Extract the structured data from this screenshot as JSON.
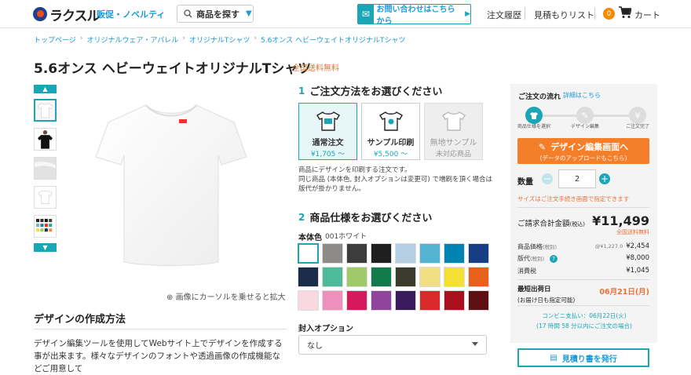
{
  "header": {
    "logo_text": "ラクスル",
    "promo_link": "販促・ノベルティ",
    "search_button": "商品を探す",
    "contact_button": "お問い合わせはこちらから",
    "order_history": "注文履歴",
    "estimate_list": "見積もりリスト",
    "cart_count": "0",
    "cart_label": "カート"
  },
  "breadcrumb": [
    "トップページ",
    "オリジナルウェア・アパレル",
    "オリジナルTシャツ",
    "5.6オンス ヘビーウェイトオリジナルTシャツ"
  ],
  "product": {
    "title": "5.6オンス ヘビーウェイトオリジナルTシャツ",
    "free_shipping": "全国送料無料",
    "zoom_note": "画像にカーソルを乗せると拡大"
  },
  "design_section": {
    "heading": "デザインの作成方法",
    "text": "デザイン編集ツールを使用してWebサイト上でデザインを作成する事が出来ます。様々なデザインのフォントや透過画像の作成機能などご用意して"
  },
  "step1": {
    "num": "1",
    "title": "ご注文方法をお選びください",
    "options": [
      {
        "label": "通常注文",
        "price": "¥1,705 〜"
      },
      {
        "label": "サンプル印刷",
        "price": "¥5,500 〜"
      },
      {
        "label": "無地サンプル",
        "price": "未対応商品"
      }
    ],
    "note": "商品にデザインを印刷する注文です。\n同じ商品 (本体色, 封入オプションは変更可) で増刷を頂く場合は版代が掛かりません。"
  },
  "step2": {
    "num": "2",
    "title": "商品仕様をお選びください",
    "color_label": "本体色",
    "color_name": "001ホワイト",
    "swatches": [
      "#ffffff",
      "#8e8a87",
      "#3c3c3c",
      "#1e1e1e",
      "#b4cfe3",
      "#56b4d3",
      "#0083b2",
      "#173d86",
      "#1b2d4a",
      "#4dbb99",
      "#9fc96a",
      "#137a4c",
      "#3b3a2c",
      "#f2df85",
      "#f4e033",
      "#e7611d",
      "#f9d9e1",
      "#ef8fbc",
      "#d5195c",
      "#91449b",
      "#3a1b5c",
      "#da2a2a",
      "#a90f1c",
      "#5e1012"
    ],
    "enclosure_label": "封入オプション",
    "enclosure_value": "なし"
  },
  "panel": {
    "flow_title": "ご注文の流れ",
    "flow_link": "詳細はこちら",
    "flow_steps": [
      "商品仕様を選択",
      "デザイン編集",
      "ご注文完了"
    ],
    "cta_title": "デザイン編集画面へ",
    "cta_sub": "(データのアップロードもこちら)",
    "qty_label": "数量",
    "qty_value": "2",
    "size_note": "サイズはご注文手続き画面で指定できます",
    "total_label": "ご請求合計金額",
    "total_tax": "(税込)",
    "total_value": "¥11,499",
    "total_sub": "全国送料無料",
    "rows": [
      {
        "label": "商品価格",
        "tax": "(税別)",
        "sub": "@¥1,227.0",
        "value": "¥2,454"
      },
      {
        "label": "版代",
        "tax": "(税別)",
        "sub": "",
        "value": "¥8,000"
      },
      {
        "label": "消費税",
        "tax": "",
        "sub": "",
        "value": "¥1,045"
      }
    ],
    "ship_label": "最短出荷日",
    "ship_sub": "(お届け日も指定可能)",
    "ship_value": "06月21日(月)",
    "conv_line1": "コンビニ支払い：06月22日(火)",
    "conv_line2": "(17 時間 58 分以内にご注文の場合)",
    "estimate_button": "見積り書を発行"
  }
}
